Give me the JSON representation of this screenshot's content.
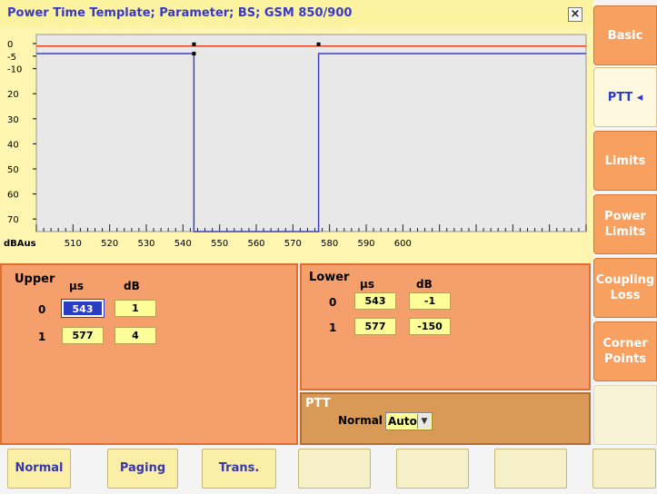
{
  "title": "Power Time Template; Parameter; BS; GSM 850/900",
  "close_label": "×",
  "chart_data": {
    "type": "line",
    "xlabel": "dBAus",
    "x_ticks": [
      "510",
      "520",
      "530",
      "540",
      "550",
      "560",
      "570",
      "580",
      "590",
      "600"
    ],
    "y_ticks": [
      "0",
      "-5",
      "-10",
      "20",
      "30",
      "40",
      "50",
      "60",
      "70"
    ],
    "xlim": [
      500,
      650
    ],
    "ylim": [
      0,
      75
    ],
    "series": [
      {
        "color": "#e04020",
        "points": [
          [
            500,
            -1
          ],
          [
            543,
            -1
          ],
          [
            543,
            1
          ],
          [
            577,
            1
          ],
          [
            577,
            -1
          ],
          [
            650,
            -1
          ]
        ]
      },
      {
        "color": "#4040c0",
        "points": [
          [
            500,
            -4
          ],
          [
            543,
            -4
          ],
          [
            543,
            -150
          ],
          [
            577,
            -150
          ],
          [
            577,
            -4
          ],
          [
            650,
            -4
          ]
        ]
      }
    ]
  },
  "upper": {
    "label": "Upper",
    "us_label": "µs",
    "db_label": "dB",
    "rows": [
      {
        "index": "0",
        "us": "543",
        "db": "1"
      },
      {
        "index": "1",
        "us": "577",
        "db": "4"
      }
    ]
  },
  "lower": {
    "label": "Lower",
    "us_label": "µs",
    "db_label": "dB",
    "rows": [
      {
        "index": "0",
        "us": "543",
        "db": "-1"
      },
      {
        "index": "1",
        "us": "577",
        "db": "-150"
      }
    ]
  },
  "ptt": {
    "label": "PTT",
    "mode_label": "Normal",
    "select_value": "Auto"
  },
  "bottom_buttons": [
    "Normal",
    "Paging",
    "Trans.",
    "",
    "",
    "",
    ""
  ],
  "side_tabs": [
    {
      "label": "Basic"
    },
    {
      "label": "PTT ◂"
    },
    {
      "label": "Limits"
    },
    {
      "label": "Power\nLimits"
    },
    {
      "label": "Coupling\nLoss"
    },
    {
      "label": "Corner\nPoints"
    },
    {
      "label": ""
    }
  ]
}
